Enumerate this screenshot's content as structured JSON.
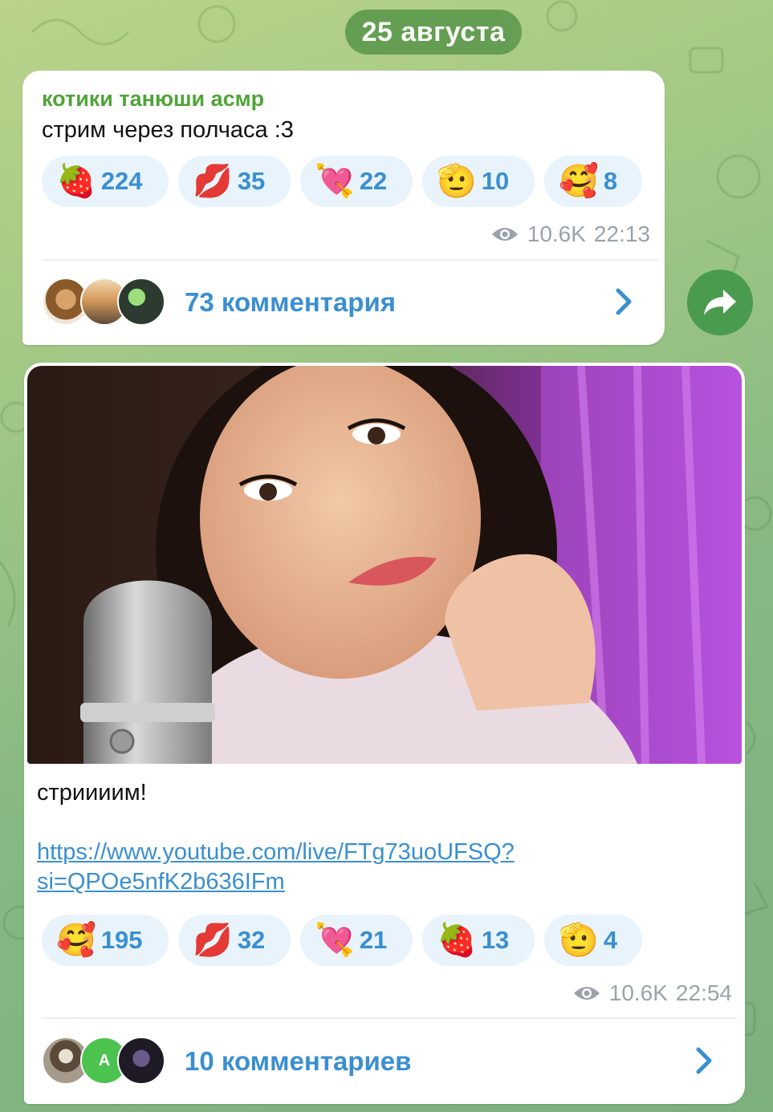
{
  "date_pill": "25 августа",
  "post1": {
    "channel": "котики танюши асмр",
    "text": "стрим через полчаса :3",
    "reactions": [
      {
        "emoji": "🍓",
        "count": "224"
      },
      {
        "emoji": "💋",
        "count": "35"
      },
      {
        "emoji": "💘",
        "count": "22"
      },
      {
        "emoji": "🫡",
        "count": "10"
      },
      {
        "emoji": "🥰",
        "count": "8"
      }
    ],
    "views": "10.6K",
    "time": "22:13",
    "comments": "73 комментария"
  },
  "post2": {
    "text": "стриииим!",
    "link": "https://www.youtube.com/live/FTg73uoUFSQ?si=QPOe5nfK2b636IFm",
    "reactions": [
      {
        "emoji": "🥰",
        "count": "195"
      },
      {
        "emoji": "💋",
        "count": "32"
      },
      {
        "emoji": "💘",
        "count": "21"
      },
      {
        "emoji": "🍓",
        "count": "13"
      },
      {
        "emoji": "🫡",
        "count": "4"
      }
    ],
    "views": "10.6K",
    "time": "22:54",
    "comments": "10 комментариев",
    "avatar_letter": "A"
  },
  "icons": {
    "views": "eye-icon",
    "comments_arrow": "chevron-right-icon",
    "share": "share-arrow-icon"
  },
  "colors": {
    "accent": "#3a8fd0",
    "channel_name": "#4fa438",
    "reaction_bg": "#e8f3fb",
    "date_pill": "#5e9a4f",
    "share_button": "#4a9b4e"
  }
}
